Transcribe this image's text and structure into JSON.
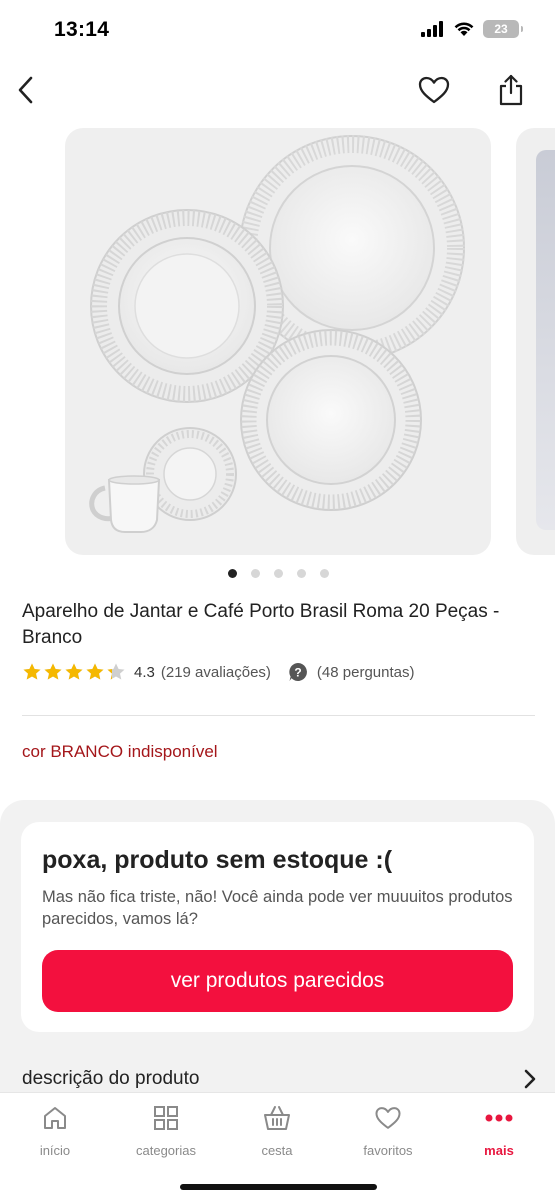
{
  "status_bar": {
    "time": "13:14",
    "battery": "23"
  },
  "product": {
    "title": "Aparelho de Jantar e Café Porto Brasil Roma 20 Peças - Branco",
    "rating_value": "4.3",
    "rating_stars": 4.3,
    "rating_count": "(219 avaliações)",
    "questions": "(48 perguntas)",
    "color_status": "cor BRANCO indisponível",
    "image_count": 5,
    "active_image": 1
  },
  "stock_card": {
    "title": "poxa, produto sem estoque :(",
    "text": "Mas não fica triste, não! Você ainda pode ver muuuitos produtos parecidos, vamos lá?",
    "button_label": "ver produtos parecidos"
  },
  "description": {
    "label": "descrição do produto"
  },
  "bottom_nav": {
    "items": [
      {
        "label": "início",
        "icon": "home-icon"
      },
      {
        "label": "categorias",
        "icon": "grid-icon"
      },
      {
        "label": "cesta",
        "icon": "basket-icon"
      },
      {
        "label": "favoritos",
        "icon": "heart-icon"
      },
      {
        "label": "mais",
        "icon": "more-dots-icon",
        "active": true
      }
    ]
  },
  "colors": {
    "accent": "#f3103e",
    "unavailable": "#a4161a",
    "star": "#f5b800"
  }
}
